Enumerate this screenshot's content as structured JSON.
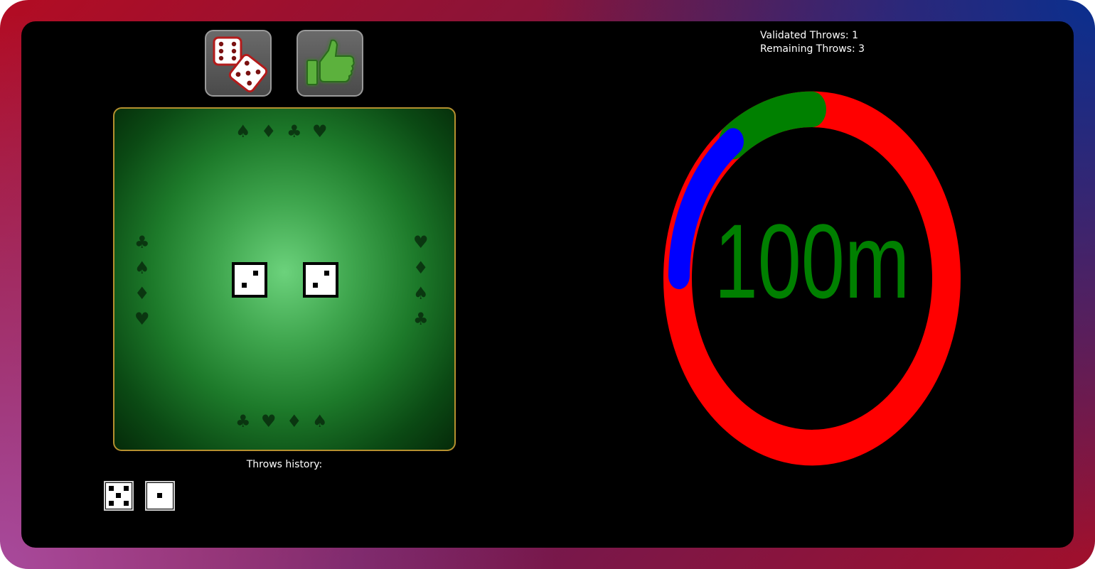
{
  "controls": {
    "roll_icon": "dice-icon",
    "validate_icon": "thumbs-up-icon"
  },
  "table": {
    "dice": [
      {
        "value": 2
      },
      {
        "value": 2
      }
    ]
  },
  "history": {
    "label": "Throws history:",
    "dice": [
      {
        "value": 5
      },
      {
        "value": 1
      }
    ]
  },
  "stats": {
    "validated": "Validated Throws: 1",
    "remaining": "Remaining Throws: 3"
  },
  "gauge": {
    "label": "100m",
    "colors": {
      "green": "#008000",
      "red": "#ff0000",
      "blue": "#0000ff",
      "text": "#008000"
    }
  }
}
